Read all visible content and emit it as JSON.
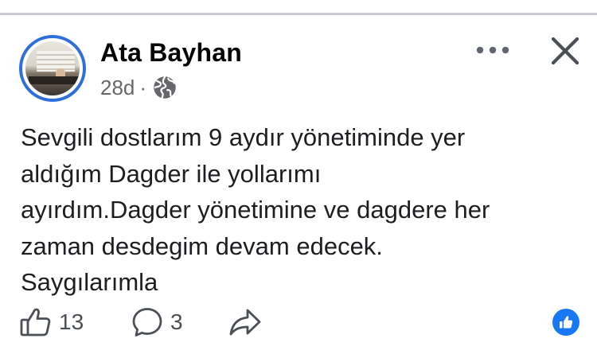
{
  "post": {
    "author": "Ata Bayhan",
    "time": "28d",
    "separator": "·",
    "audience_icon": "globe-icon",
    "text": "Sevgili dostlarım 9 aydır yönetiminde yer\naldığım Dagder ile yollarımı\nayırdım.Dagder yönetimine ve dagdere her\nzaman desdegim devam edecek.\nSaygılarımla",
    "avatar_ring_color": "#2f6fdc"
  },
  "header_actions": {
    "more_icon": "more-dots-icon",
    "close_icon": "close-icon"
  },
  "actions": {
    "like_count": "13",
    "comment_count": "3",
    "like_icon": "thumbs-up-icon",
    "comment_icon": "comment-bubble-icon",
    "share_icon": "share-arrow-icon"
  },
  "reaction": {
    "icon": "like-reaction-icon",
    "color": "#1877f2"
  }
}
